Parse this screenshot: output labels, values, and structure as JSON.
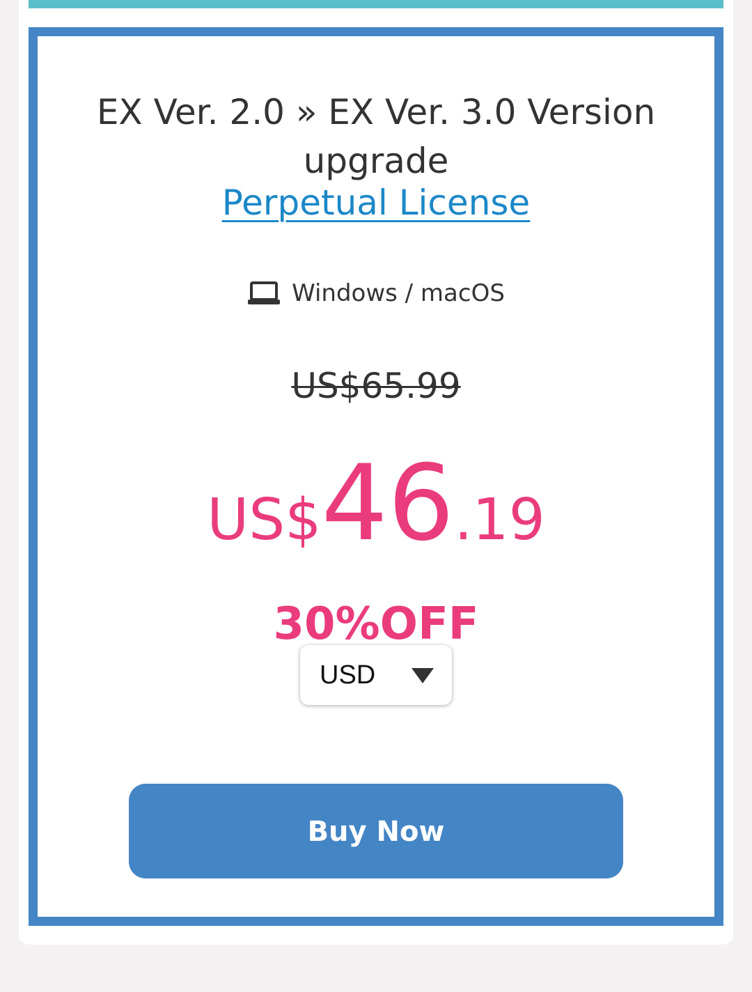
{
  "plan": {
    "title_line1": "EX Ver. 2.0 » EX Ver. 3.0 Version",
    "title_line2": "upgrade",
    "license_link": "Perpetual License",
    "platform_icon": "laptop-icon",
    "platform": "Windows / macOS",
    "original_price": "US$65.99",
    "sale_price": {
      "currency": "US$",
      "integer": "46",
      "decimal": ".19"
    },
    "discount": "30%OFF",
    "currency_select": {
      "selected": "USD"
    },
    "buy_label": "Buy Now"
  },
  "colors": {
    "top_strip": "#5bbdc9",
    "card_border": "#4485c5",
    "link": "#1b87c8",
    "sale": "#ea3c7d",
    "button": "#4485c5",
    "background": "#f3f1f2"
  }
}
